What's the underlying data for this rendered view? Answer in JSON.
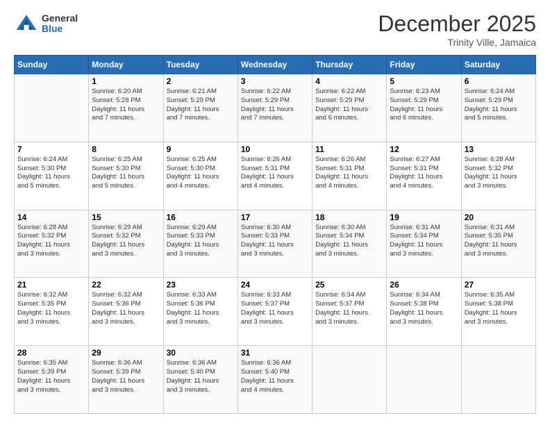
{
  "header": {
    "logo": {
      "general": "General",
      "blue": "Blue"
    },
    "title": "December 2025",
    "location": "Trinity Ville, Jamaica"
  },
  "days_of_week": [
    "Sunday",
    "Monday",
    "Tuesday",
    "Wednesday",
    "Thursday",
    "Friday",
    "Saturday"
  ],
  "weeks": [
    [
      {
        "day": "",
        "info": ""
      },
      {
        "day": "1",
        "info": "Sunrise: 6:20 AM\nSunset: 5:28 PM\nDaylight: 11 hours\nand 7 minutes."
      },
      {
        "day": "2",
        "info": "Sunrise: 6:21 AM\nSunset: 5:29 PM\nDaylight: 11 hours\nand 7 minutes."
      },
      {
        "day": "3",
        "info": "Sunrise: 6:22 AM\nSunset: 5:29 PM\nDaylight: 11 hours\nand 7 minutes."
      },
      {
        "day": "4",
        "info": "Sunrise: 6:22 AM\nSunset: 5:29 PM\nDaylight: 11 hours\nand 6 minutes."
      },
      {
        "day": "5",
        "info": "Sunrise: 6:23 AM\nSunset: 5:29 PM\nDaylight: 11 hours\nand 6 minutes."
      },
      {
        "day": "6",
        "info": "Sunrise: 6:24 AM\nSunset: 5:29 PM\nDaylight: 11 hours\nand 5 minutes."
      }
    ],
    [
      {
        "day": "7",
        "info": "Sunrise: 6:24 AM\nSunset: 5:30 PM\nDaylight: 11 hours\nand 5 minutes."
      },
      {
        "day": "8",
        "info": "Sunrise: 6:25 AM\nSunset: 5:30 PM\nDaylight: 11 hours\nand 5 minutes."
      },
      {
        "day": "9",
        "info": "Sunrise: 6:25 AM\nSunset: 5:30 PM\nDaylight: 11 hours\nand 4 minutes."
      },
      {
        "day": "10",
        "info": "Sunrise: 6:26 AM\nSunset: 5:31 PM\nDaylight: 11 hours\nand 4 minutes."
      },
      {
        "day": "11",
        "info": "Sunrise: 6:26 AM\nSunset: 5:31 PM\nDaylight: 11 hours\nand 4 minutes."
      },
      {
        "day": "12",
        "info": "Sunrise: 6:27 AM\nSunset: 5:31 PM\nDaylight: 11 hours\nand 4 minutes."
      },
      {
        "day": "13",
        "info": "Sunrise: 6:28 AM\nSunset: 5:32 PM\nDaylight: 11 hours\nand 3 minutes."
      }
    ],
    [
      {
        "day": "14",
        "info": "Sunrise: 6:28 AM\nSunset: 5:32 PM\nDaylight: 11 hours\nand 3 minutes."
      },
      {
        "day": "15",
        "info": "Sunrise: 6:29 AM\nSunset: 5:32 PM\nDaylight: 11 hours\nand 3 minutes."
      },
      {
        "day": "16",
        "info": "Sunrise: 6:29 AM\nSunset: 5:33 PM\nDaylight: 11 hours\nand 3 minutes."
      },
      {
        "day": "17",
        "info": "Sunrise: 6:30 AM\nSunset: 5:33 PM\nDaylight: 11 hours\nand 3 minutes."
      },
      {
        "day": "18",
        "info": "Sunrise: 6:30 AM\nSunset: 5:34 PM\nDaylight: 11 hours\nand 3 minutes."
      },
      {
        "day": "19",
        "info": "Sunrise: 6:31 AM\nSunset: 5:34 PM\nDaylight: 11 hours\nand 3 minutes."
      },
      {
        "day": "20",
        "info": "Sunrise: 6:31 AM\nSunset: 5:35 PM\nDaylight: 11 hours\nand 3 minutes."
      }
    ],
    [
      {
        "day": "21",
        "info": "Sunrise: 6:32 AM\nSunset: 5:35 PM\nDaylight: 11 hours\nand 3 minutes."
      },
      {
        "day": "22",
        "info": "Sunrise: 6:32 AM\nSunset: 5:36 PM\nDaylight: 11 hours\nand 3 minutes."
      },
      {
        "day": "23",
        "info": "Sunrise: 6:33 AM\nSunset: 5:36 PM\nDaylight: 11 hours\nand 3 minutes."
      },
      {
        "day": "24",
        "info": "Sunrise: 6:33 AM\nSunset: 5:37 PM\nDaylight: 11 hours\nand 3 minutes."
      },
      {
        "day": "25",
        "info": "Sunrise: 6:34 AM\nSunset: 5:37 PM\nDaylight: 11 hours\nand 3 minutes."
      },
      {
        "day": "26",
        "info": "Sunrise: 6:34 AM\nSunset: 5:38 PM\nDaylight: 11 hours\nand 3 minutes."
      },
      {
        "day": "27",
        "info": "Sunrise: 6:35 AM\nSunset: 5:38 PM\nDaylight: 11 hours\nand 3 minutes."
      }
    ],
    [
      {
        "day": "28",
        "info": "Sunrise: 6:35 AM\nSunset: 5:39 PM\nDaylight: 11 hours\nand 3 minutes."
      },
      {
        "day": "29",
        "info": "Sunrise: 6:36 AM\nSunset: 5:39 PM\nDaylight: 11 hours\nand 3 minutes."
      },
      {
        "day": "30",
        "info": "Sunrise: 6:36 AM\nSunset: 5:40 PM\nDaylight: 11 hours\nand 3 minutes."
      },
      {
        "day": "31",
        "info": "Sunrise: 6:36 AM\nSunset: 5:40 PM\nDaylight: 11 hours\nand 4 minutes."
      },
      {
        "day": "",
        "info": ""
      },
      {
        "day": "",
        "info": ""
      },
      {
        "day": "",
        "info": ""
      }
    ]
  ]
}
